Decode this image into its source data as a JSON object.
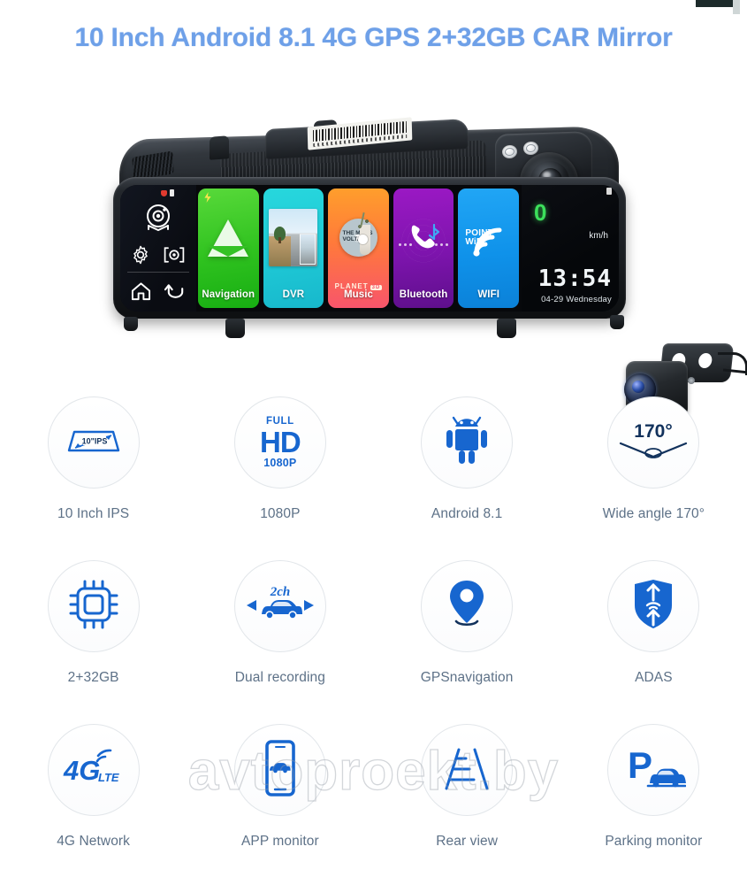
{
  "page": {
    "title": "10 Inch Android 8.1 4G GPS 2+32GB CAR Mirror",
    "title_color": "#6ea0e8",
    "accent_color": "#1766cf",
    "label_color": "#5d7187",
    "watermark": "avtoproekt.by"
  },
  "device": {
    "label_note": "barcode-label",
    "screen": {
      "status_icons": [
        "record-dot",
        "sim-card"
      ],
      "controls": [
        {
          "name": "camera-icon",
          "label": "Camera"
        },
        {
          "name": "settings-gear-icon",
          "label": "Settings"
        },
        {
          "name": "screenshot-icon",
          "label": "Screenshot"
        },
        {
          "name": "home-icon",
          "label": "Home"
        },
        {
          "name": "back-icon",
          "label": "Back"
        }
      ],
      "tiles": [
        {
          "label": "Navigation",
          "icon": "navigation-arrow-icon",
          "color": "#2fc21f"
        },
        {
          "label": "DVR",
          "icon": "dashcam-photo-icon",
          "color": "#1fc9d6"
        },
        {
          "label": "Music",
          "icon": "album-disc-icon",
          "color": "#ff7a3a",
          "album_artist": "THE MARS VOLTA",
          "album_name": "PLANET",
          "album_tag": "3D"
        },
        {
          "label": "Bluetooth",
          "icon": "bluetooth-phone-icon",
          "color": "#7d14ad"
        },
        {
          "label": "WIFI",
          "icon": "wifi-signal-icon",
          "color": "#0f92ea",
          "overlay_line1": "POINT",
          "overlay_line2": "WiFi"
        }
      ],
      "dashboard": {
        "speed": "0",
        "speed_unit": "km/h",
        "time": "13:54",
        "date": "04-29  Wednesday"
      }
    }
  },
  "features": [
    [
      {
        "label": "10 Inch IPS",
        "icon": "mirror-screen-icon",
        "art_text": "10\"IPS"
      },
      {
        "label": "1080P",
        "icon": "full-hd-icon",
        "art_top": "FULL",
        "art_mid": "HD",
        "art_bottom": "1080P"
      },
      {
        "label": "Android 8.1",
        "icon": "android-robot-icon"
      },
      {
        "label": "Wide angle 170°",
        "icon": "wide-angle-icon",
        "art_text": "170°"
      }
    ],
    [
      {
        "label": "2+32GB",
        "icon": "cpu-chip-icon"
      },
      {
        "label": "Dual recording",
        "icon": "dual-channel-car-icon",
        "art_text": "2ch"
      },
      {
        "label": "GPSnavigation",
        "icon": "map-pin-icon"
      },
      {
        "label": "ADAS",
        "icon": "shield-arrows-icon"
      }
    ],
    [
      {
        "label": "4G Network",
        "icon": "4g-lte-icon",
        "art_text": "4G",
        "art_sub": "LTE"
      },
      {
        "label": "APP monitor",
        "icon": "phone-car-icon"
      },
      {
        "label": "Rear view",
        "icon": "rear-view-lines-icon"
      },
      {
        "label": "Parking monitor",
        "icon": "parking-car-icon"
      }
    ]
  ]
}
